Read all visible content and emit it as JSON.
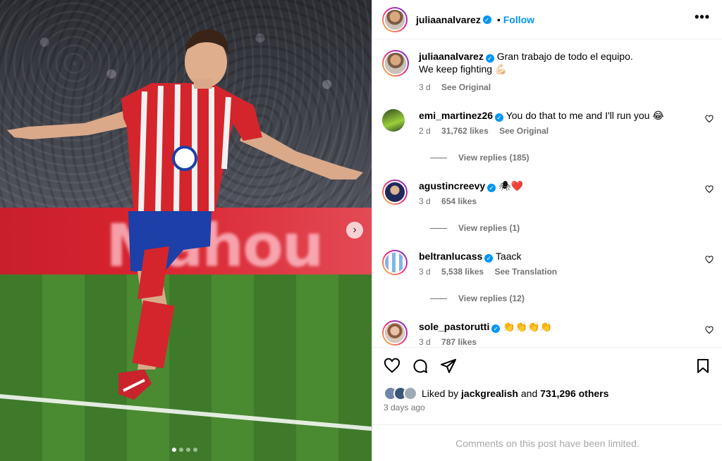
{
  "header": {
    "username": "juliaanalvarez",
    "separator": "•",
    "follow_label": "Follow",
    "more_label": "•••"
  },
  "caption": {
    "username": "juliaanalvarez",
    "text_line1": "Gran trabajo de todo el equipo.",
    "text_line2": "We keep fighting 💪🏻",
    "age": "3 d",
    "see_original": "See Original"
  },
  "comments": [
    {
      "username": "emi_martinez26",
      "text": "You do that to me and I'll run you 😂",
      "age": "2 d",
      "likes": "31,762 likes",
      "action": "See Original",
      "replies": "View replies (185)"
    },
    {
      "username": "agustincreevy",
      "text": "🕷❤️",
      "age": "3 d",
      "likes": "654 likes",
      "action": "",
      "replies": "View replies (1)"
    },
    {
      "username": "beltranlucass",
      "text": "Taack",
      "age": "3 d",
      "likes": "5,538 likes",
      "action": "See Translation",
      "replies": "View replies (12)"
    },
    {
      "username": "sole_pastorutti",
      "text": "👏👏👏👏",
      "age": "3 d",
      "likes": "787 likes",
      "action": "",
      "replies": ""
    }
  ],
  "post": {
    "liked_prefix": "Liked by",
    "liked_user": "jackgrealish",
    "liked_and": "and",
    "liked_others": "731,296 others",
    "time_ago": "3 days ago",
    "limited_notice": "Comments on this post have been limited."
  },
  "media": {
    "ad_text": "Mahou",
    "carousel_index": 1,
    "carousel_total": 4
  },
  "colors": {
    "accent": "#0095f6",
    "muted": "#737373",
    "jersey_red": "#d4252c",
    "shorts_blue": "#1c3fa8"
  }
}
